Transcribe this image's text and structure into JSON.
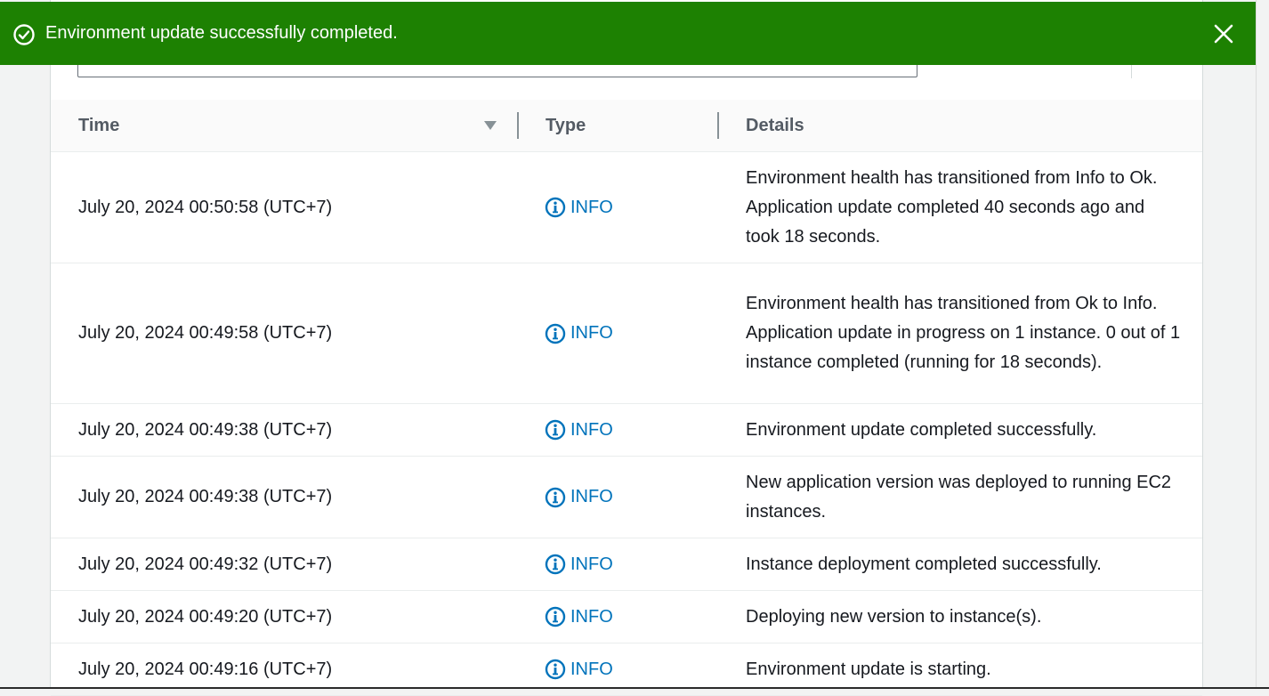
{
  "flash": {
    "message": "Environment update successfully completed.",
    "type": "success",
    "color": "#1d8102"
  },
  "table": {
    "columns": {
      "time": "Time",
      "type": "Type",
      "details": "Details"
    },
    "rows": [
      {
        "time": "July 20, 2024 00:50:58 (UTC+7)",
        "type": "INFO",
        "details": "Environment health has transitioned from Info to Ok. Application update completed 40 seconds ago and took 18 seconds."
      },
      {
        "time": "July 20, 2024 00:49:58 (UTC+7)",
        "type": "INFO",
        "details": "Environment health has transitioned from Ok to Info. Application update in progress on 1 instance. 0 out of 1 instance completed (running for 18 seconds)."
      },
      {
        "time": "July 20, 2024 00:49:38 (UTC+7)",
        "type": "INFO",
        "details": "Environment update completed successfully."
      },
      {
        "time": "July 20, 2024 00:49:38 (UTC+7)",
        "type": "INFO",
        "details": "New application version was deployed to running EC2 instances."
      },
      {
        "time": "July 20, 2024 00:49:32 (UTC+7)",
        "type": "INFO",
        "details": "Instance deployment completed successfully."
      },
      {
        "time": "July 20, 2024 00:49:20 (UTC+7)",
        "type": "INFO",
        "details": "Deploying new version to instance(s)."
      },
      {
        "time": "July 20, 2024 00:49:16 (UTC+7)",
        "type": "INFO",
        "details": "Environment update is starting."
      }
    ]
  },
  "icons": {
    "flash": "check-circle-icon",
    "close": "close-icon",
    "sort": "sort-descending-icon",
    "info": "info-icon"
  },
  "colors": {
    "link": "#0073bb",
    "success": "#1d8102"
  }
}
